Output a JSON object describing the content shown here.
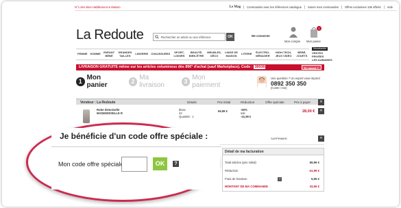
{
  "top_bar": {
    "tagline": "N°1 des sites Habillement & Maison",
    "links": [
      "Le Mag",
      "Commander avec les références catalogue",
      "Suivre mes commandes",
      "Offres exclusives 10€ offerts",
      "Aide"
    ]
  },
  "header": {
    "logo": "La Redoute",
    "search_placeholder": "Rechercher un article ou une référence",
    "search_button": "OK",
    "account_status": "Me connecter",
    "account_label": "Mon compte",
    "basket_label": "Mon panier",
    "basket_count": "1"
  },
  "nav": {
    "items": [
      "FEMME",
      "HOMME",
      "ENFANT BÉBÉ",
      "GRANDES TAILLES",
      "LINGERIE",
      "CHAUSSURES",
      "SPORT, LOISIRS",
      "BEAUTÉ, BIEN-ÊTRE",
      "MEUBLES, DÉCO",
      "LINGE DE MAISON",
      "LITERIE",
      "ÉLECTRO-MÉNAGER",
      "HIGH-TECH, JEUX VIDÉO",
      "BÉBÉ, JOUETS",
      "VENTES PRIVÉES",
      "LES AUBAINES"
    ],
    "badge": "Nouveautés"
  },
  "promo": {
    "text": "LIVRAISON GRATUITE même sur les articles volumineux dès 89€* d'achat (sauf Marketplace). Code :",
    "code": "38938",
    "more": "En savoir +"
  },
  "steps": [
    {
      "num": "1",
      "label": "Mon panier",
      "active": true
    },
    {
      "num": "2",
      "label": "Ma livraison",
      "active": false
    },
    {
      "num": "3",
      "label": "Mon paiement",
      "active": false
    }
  ],
  "help": {
    "question": "Une question ? Un expert vous répond",
    "phone": "0892 350 350",
    "price": "(0,34€ / min)"
  },
  "cart_table": {
    "vendor": "Vendeur : La Redoute",
    "headers": [
      "Détails",
      "Prix initial",
      "Réduction",
      "Offre spéciale",
      "Prix à payer"
    ],
    "product_name": "Robe demoiselle MADEMOISELLE R",
    "product_ref": "MADEMOISELLE R",
    "details": [
      "blanc",
      "42",
      "Quantité : 1"
    ],
    "initial_price": "69,99 €",
    "reduction": [
      "-60%",
      "soit",
      "-41,99 €"
    ],
    "pay_price": "28,00 €",
    "delete": "SUPPRIMER"
  },
  "billing": {
    "title": "Détail de ma facturation",
    "lines": [
      {
        "label": "Total articles (prix initial)",
        "value": "69,99 €"
      },
      {
        "label": "Réduction",
        "value": "-41,99 €"
      },
      {
        "label": "Frais de livraison",
        "value": "5,95 €"
      },
      {
        "label": "MONTANT DE MA COMMANDE",
        "value": "33,95 €"
      }
    ]
  },
  "offer": {
    "title": "Je bénéficie d'un code offre spéciale :",
    "label": "Mon code offre spéciale",
    "button": "OK",
    "help": "?"
  },
  "colors": {
    "brand_red": "#c8102e",
    "highlight_ring": "#cc2a4e",
    "ok_green": "#8dc63f"
  }
}
